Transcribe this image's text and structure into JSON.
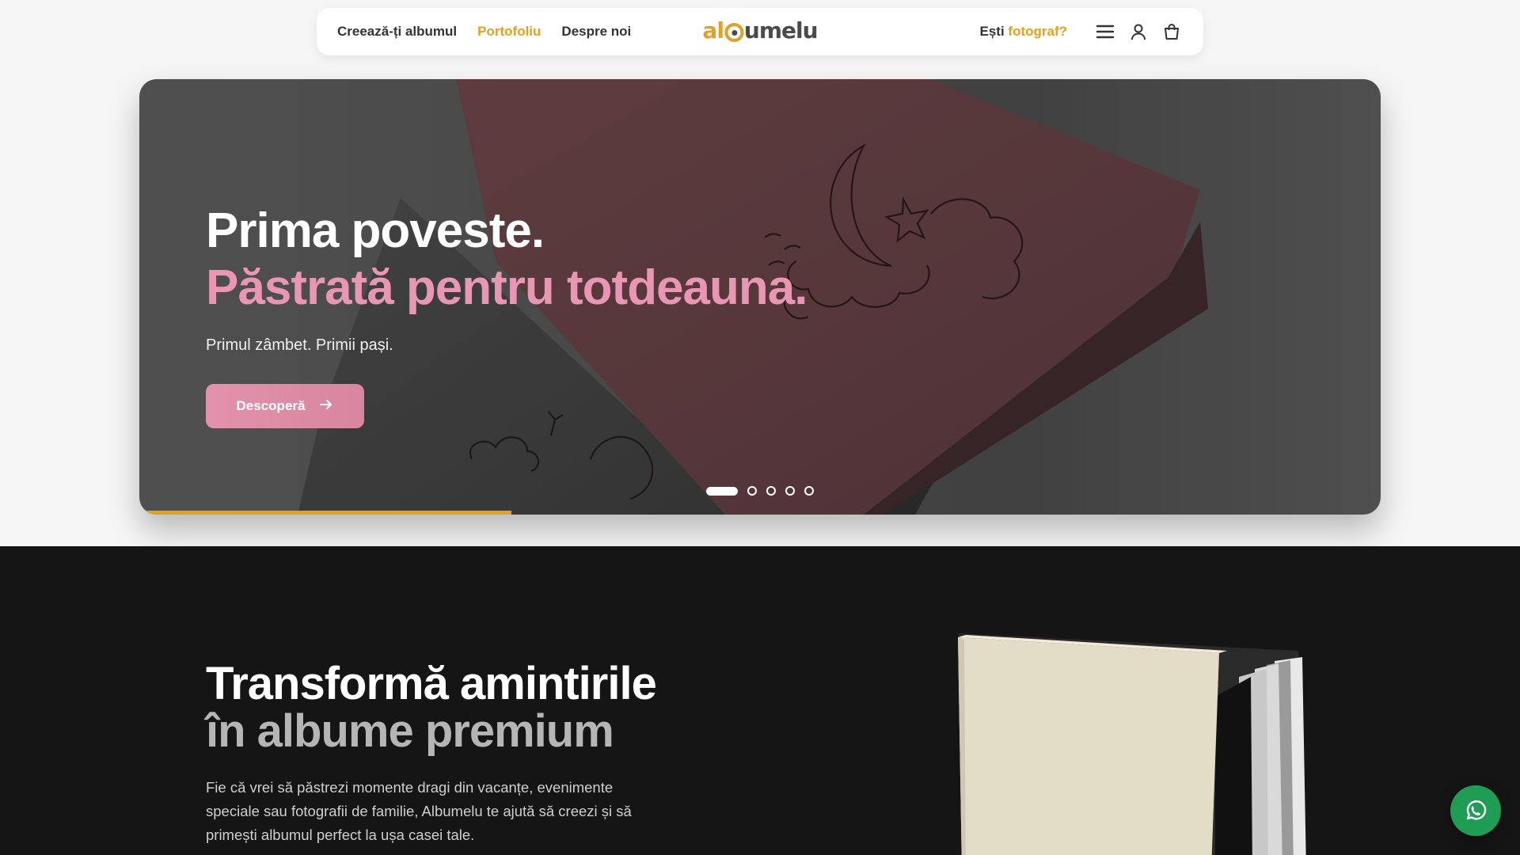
{
  "nav": {
    "links": [
      {
        "label": "Creează-ți albumul"
      },
      {
        "label": "Portofoliu"
      },
      {
        "label": "Despre noi"
      }
    ],
    "logo": {
      "part1": "al",
      "part2": "b",
      "part3": "umelu"
    },
    "photographer_prefix": "Ești",
    "photographer_highlight": "fotograf?",
    "icons": [
      "menu-icon",
      "user-icon",
      "cart-icon"
    ]
  },
  "hero": {
    "title_line1": "Prima poveste.",
    "title_line2": "Păstrată pentru totdeauna.",
    "subtitle": "Primul zâmbet. Primii pași.",
    "cta_label": "Descoperă",
    "slides_total": 5,
    "active_slide": 1,
    "progress_fraction": 0.3
  },
  "section": {
    "title_line1": "Transformă amintirile",
    "title_line2": "în albume premium",
    "description": "Fie că vrei să păstrezi momente dragi din vacanțe, evenimente speciale sau fotografii de familie, Albumelu te ajută să creezi și să primești albumul perfect la ușa casei tale."
  },
  "colors": {
    "accent": "#e0a224",
    "pink": "#e995b4",
    "dark_bg": "#151515",
    "whatsapp": "#1f9d55"
  }
}
